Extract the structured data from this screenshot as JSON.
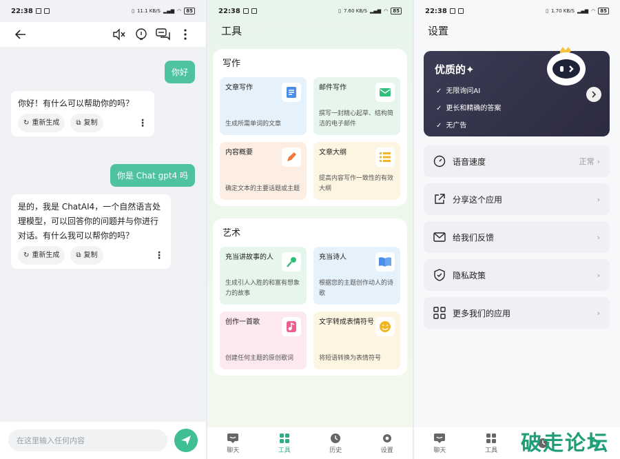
{
  "status": {
    "time": "22:38",
    "battery": "85",
    "net1": "11.1 KB/S",
    "net2": "7.60 KB/S",
    "net3": "1.70 KB/S"
  },
  "chat": {
    "messages": [
      {
        "role": "user",
        "text": "你好"
      },
      {
        "role": "bot",
        "text": "你好！有什么可以帮助你的吗？"
      },
      {
        "role": "user",
        "text": "你是 Chat gpt4 吗"
      },
      {
        "role": "bot",
        "text": "是的，我是 ChatAI4，一个自然语言处理模型，可以回答你的问题并与你进行对话。有什么我可以帮你的吗？"
      }
    ],
    "regenerate_label": "重新生成",
    "copy_label": "复制",
    "input_placeholder": "在这里输入任何内容"
  },
  "tools": {
    "title": "工具",
    "sections": [
      {
        "title": "写作",
        "cards": [
          {
            "title": "文章写作",
            "desc": "生成所需单词的文章",
            "icon": "document-icon"
          },
          {
            "title": "邮件写作",
            "desc": "撰写一封精心起草、结构简洁的电子邮件",
            "icon": "mail-icon"
          },
          {
            "title": "内容概要",
            "desc": "确定文本的主要话题或主题",
            "icon": "pen-icon"
          },
          {
            "title": "文章大纲",
            "desc": "提高内容写作一致性的有效大纲",
            "icon": "list-icon"
          }
        ]
      },
      {
        "title": "艺术",
        "cards": [
          {
            "title": "充当讲故事的人",
            "desc": "生成引人入胜的和富有想象力的故事",
            "icon": "microphone-icon"
          },
          {
            "title": "充当诗人",
            "desc": "根据您的主题创作动人的诗歌",
            "icon": "book-icon"
          },
          {
            "title": "创作一首歌",
            "desc": "创建任何主题的原创歌词",
            "icon": "music-icon"
          },
          {
            "title": "文字转成表情符号",
            "desc": "将短语转换为表情符号",
            "icon": "smiley-icon"
          }
        ]
      }
    ]
  },
  "tabbar": {
    "items": [
      {
        "label": "聊天",
        "icon": "chat-icon"
      },
      {
        "label": "工具",
        "icon": "grid-icon"
      },
      {
        "label": "历史",
        "icon": "clock-icon"
      },
      {
        "label": "设置",
        "icon": "gear-icon"
      }
    ]
  },
  "settings": {
    "title": "设置",
    "promo": {
      "title": "优质的",
      "features": [
        "无限询问AI",
        "更长和精确的答案",
        "无广告"
      ]
    },
    "items": [
      {
        "label": "语音速度",
        "value": "正常",
        "icon": "speed-icon"
      },
      {
        "label": "分享这个应用",
        "value": "",
        "icon": "share-icon"
      },
      {
        "label": "给我们反馈",
        "value": "",
        "icon": "feedback-mail-icon"
      },
      {
        "label": "隐私政策",
        "value": "",
        "icon": "shield-icon"
      },
      {
        "label": "更多我们的应用",
        "value": "",
        "icon": "apps-icon"
      }
    ]
  },
  "watermark": "破走论坛",
  "colors": {
    "accent": "#3fbf92",
    "user_bubble": "#4fc3a1",
    "promo_bg": "#2f2e44"
  }
}
